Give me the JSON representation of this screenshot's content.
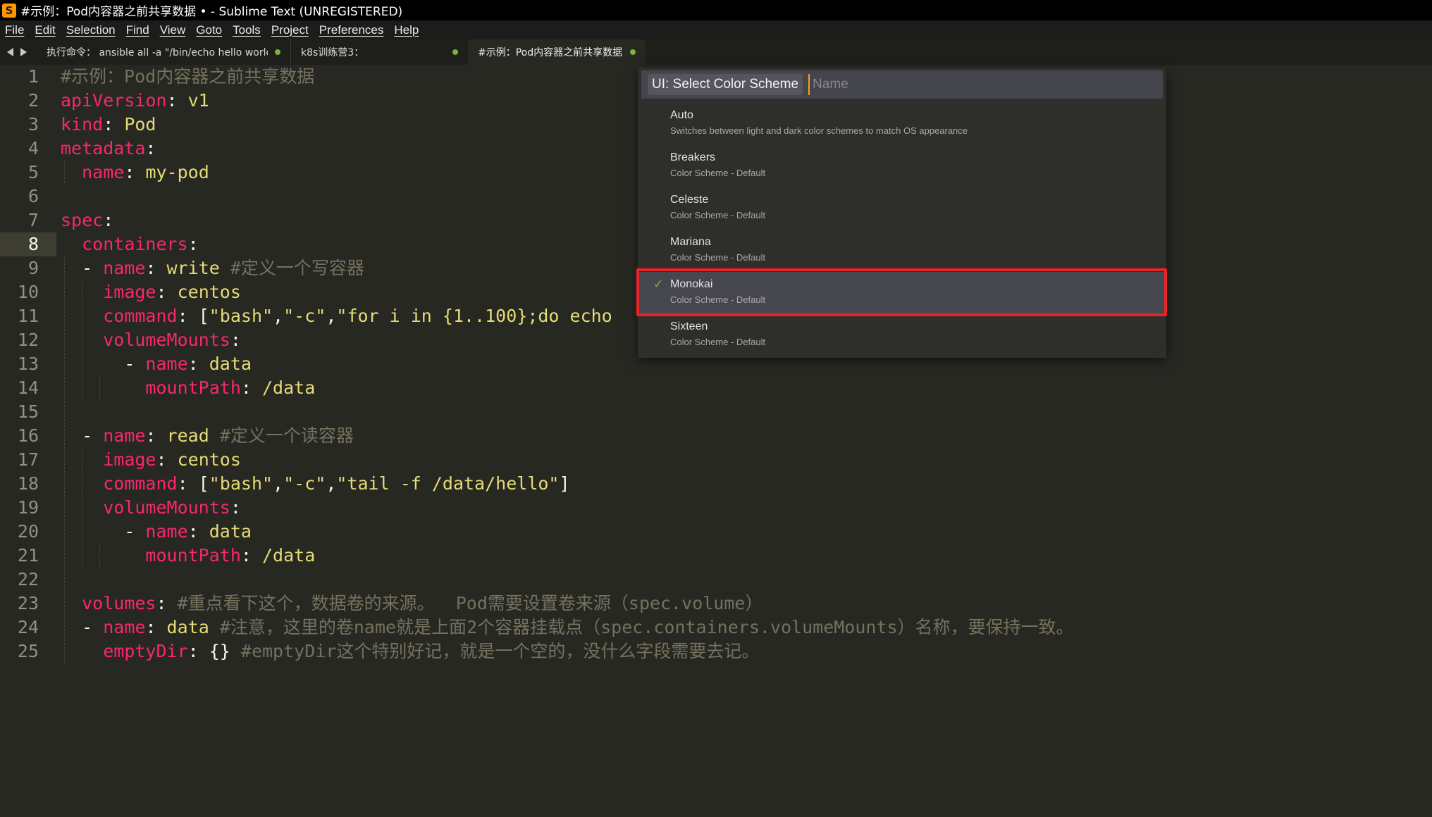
{
  "window": {
    "title": "#示例：Pod内容器之前共享数据 • - Sublime Text (UNREGISTERED)",
    "logo_letter": "S"
  },
  "menu": [
    "File",
    "Edit",
    "Selection",
    "Find",
    "View",
    "Goto",
    "Tools",
    "Project",
    "Preferences",
    "Help"
  ],
  "tabs": [
    {
      "label": "执行命令： ansible all -a \"/bin/echo hello world\"",
      "dirty": true,
      "active": false
    },
    {
      "label": "k8s训练营3：",
      "dirty": true,
      "active": false
    },
    {
      "label": "#示例：Pod内容器之前共享数据",
      "dirty": true,
      "active": true
    }
  ],
  "editor": {
    "current_line": 8,
    "line_numbers": [
      "1",
      "2",
      "3",
      "4",
      "5",
      "6",
      "7",
      "8",
      "9",
      "10",
      "11",
      "12",
      "13",
      "14",
      "15",
      "16",
      "17",
      "18",
      "19",
      "20",
      "21",
      "22",
      "23",
      "24",
      "25"
    ],
    "lines": [
      [
        {
          "t": "c",
          "v": "#示例：Pod内容器之前共享数据"
        }
      ],
      [
        {
          "t": "k",
          "v": "apiVersion"
        },
        {
          "t": "p",
          "v": ": "
        },
        {
          "t": "s",
          "v": "v1"
        }
      ],
      [
        {
          "t": "k",
          "v": "kind"
        },
        {
          "t": "p",
          "v": ": "
        },
        {
          "t": "s",
          "v": "Pod"
        }
      ],
      [
        {
          "t": "k",
          "v": "metadata"
        },
        {
          "t": "p",
          "v": ":"
        }
      ],
      [
        {
          "t": "p",
          "v": "  "
        },
        {
          "t": "k",
          "v": "name"
        },
        {
          "t": "p",
          "v": ": "
        },
        {
          "t": "s",
          "v": "my-pod"
        }
      ],
      [],
      [
        {
          "t": "k",
          "v": "spec"
        },
        {
          "t": "p",
          "v": ":"
        }
      ],
      [
        {
          "t": "p",
          "v": "  "
        },
        {
          "t": "k",
          "v": "containers"
        },
        {
          "t": "p",
          "v": ":"
        }
      ],
      [
        {
          "t": "p",
          "v": "  - "
        },
        {
          "t": "k",
          "v": "name"
        },
        {
          "t": "p",
          "v": ": "
        },
        {
          "t": "s",
          "v": "write "
        },
        {
          "t": "c",
          "v": "#定义一个写容器"
        }
      ],
      [
        {
          "t": "p",
          "v": "    "
        },
        {
          "t": "k",
          "v": "image"
        },
        {
          "t": "p",
          "v": ": "
        },
        {
          "t": "s",
          "v": "centos"
        }
      ],
      [
        {
          "t": "p",
          "v": "    "
        },
        {
          "t": "k",
          "v": "command"
        },
        {
          "t": "p",
          "v": ": ["
        },
        {
          "t": "s",
          "v": "\"bash\""
        },
        {
          "t": "p",
          "v": ","
        },
        {
          "t": "s",
          "v": "\"-c\""
        },
        {
          "t": "p",
          "v": ","
        },
        {
          "t": "s",
          "v": "\"for i in {1..100};do echo"
        }
      ],
      [
        {
          "t": "p",
          "v": "    "
        },
        {
          "t": "k",
          "v": "volumeMounts"
        },
        {
          "t": "p",
          "v": ":"
        }
      ],
      [
        {
          "t": "p",
          "v": "      - "
        },
        {
          "t": "k",
          "v": "name"
        },
        {
          "t": "p",
          "v": ": "
        },
        {
          "t": "s",
          "v": "data"
        }
      ],
      [
        {
          "t": "p",
          "v": "        "
        },
        {
          "t": "k",
          "v": "mountPath"
        },
        {
          "t": "p",
          "v": ": "
        },
        {
          "t": "s",
          "v": "/data"
        }
      ],
      [],
      [
        {
          "t": "p",
          "v": "  - "
        },
        {
          "t": "k",
          "v": "name"
        },
        {
          "t": "p",
          "v": ": "
        },
        {
          "t": "s",
          "v": "read "
        },
        {
          "t": "c",
          "v": "#定义一个读容器"
        }
      ],
      [
        {
          "t": "p",
          "v": "    "
        },
        {
          "t": "k",
          "v": "image"
        },
        {
          "t": "p",
          "v": ": "
        },
        {
          "t": "s",
          "v": "centos"
        }
      ],
      [
        {
          "t": "p",
          "v": "    "
        },
        {
          "t": "k",
          "v": "command"
        },
        {
          "t": "p",
          "v": ": ["
        },
        {
          "t": "s",
          "v": "\"bash\""
        },
        {
          "t": "p",
          "v": ","
        },
        {
          "t": "s",
          "v": "\"-c\""
        },
        {
          "t": "p",
          "v": ","
        },
        {
          "t": "s",
          "v": "\"tail -f /data/hello\""
        },
        {
          "t": "p",
          "v": "]"
        }
      ],
      [
        {
          "t": "p",
          "v": "    "
        },
        {
          "t": "k",
          "v": "volumeMounts"
        },
        {
          "t": "p",
          "v": ":"
        }
      ],
      [
        {
          "t": "p",
          "v": "      - "
        },
        {
          "t": "k",
          "v": "name"
        },
        {
          "t": "p",
          "v": ": "
        },
        {
          "t": "s",
          "v": "data"
        }
      ],
      [
        {
          "t": "p",
          "v": "        "
        },
        {
          "t": "k",
          "v": "mountPath"
        },
        {
          "t": "p",
          "v": ": "
        },
        {
          "t": "s",
          "v": "/data"
        }
      ],
      [],
      [
        {
          "t": "p",
          "v": "  "
        },
        {
          "t": "k",
          "v": "volumes"
        },
        {
          "t": "p",
          "v": ": "
        },
        {
          "t": "c",
          "v": "#重点看下这个，数据卷的来源。  Pod需要设置卷来源（spec.volume）"
        }
      ],
      [
        {
          "t": "p",
          "v": "  - "
        },
        {
          "t": "k",
          "v": "name"
        },
        {
          "t": "p",
          "v": ": "
        },
        {
          "t": "s",
          "v": "data "
        },
        {
          "t": "c",
          "v": "#注意，这里的卷name就是上面2个容器挂载点（spec.containers.volumeMounts）名称，要保持一致。"
        }
      ],
      [
        {
          "t": "p",
          "v": "    "
        },
        {
          "t": "k",
          "v": "emptyDir"
        },
        {
          "t": "p",
          "v": ": {} "
        },
        {
          "t": "c",
          "v": "#emptyDir这个特别好记，就是一个空的，没什么字段需要去记。"
        }
      ]
    ]
  },
  "palette": {
    "prefix": "UI: Select Color Scheme",
    "placeholder": "Name",
    "items": [
      {
        "title": "Auto",
        "subtitle": "Switches between light and dark color schemes to match OS appearance",
        "selected": false
      },
      {
        "title": "Breakers",
        "subtitle": "Color Scheme - Default",
        "selected": false
      },
      {
        "title": "Celeste",
        "subtitle": "Color Scheme - Default",
        "selected": false
      },
      {
        "title": "Mariana",
        "subtitle": "Color Scheme - Default",
        "selected": false
      },
      {
        "title": "Monokai",
        "subtitle": "Color Scheme - Default",
        "selected": true
      },
      {
        "title": "Sixteen",
        "subtitle": "Color Scheme - Default",
        "selected": false
      }
    ],
    "check_glyph": "✓"
  },
  "colors": {
    "keyword": "#f92672",
    "string": "#e6db74",
    "comment": "#75715e",
    "background": "#272822",
    "highlight_box": "#e8232a",
    "dirty_dot": "#7fb13f"
  }
}
